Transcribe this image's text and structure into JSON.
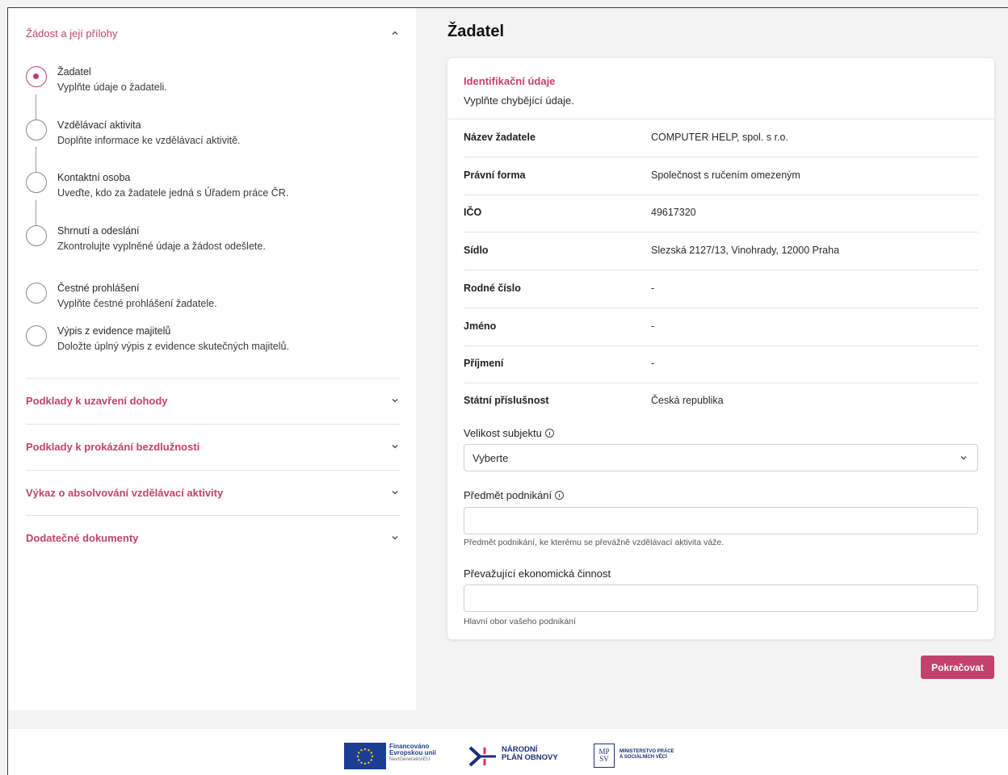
{
  "sidebar": {
    "section_open": {
      "title": "Žádost a její přílohy"
    },
    "steps": [
      {
        "title": "Žadatel",
        "desc": "Vyplňte údaje o žadateli."
      },
      {
        "title": "Vzdělávací aktivita",
        "desc": "Doplňte informace ke vzdělávací aktivitě."
      },
      {
        "title": "Kontaktní osoba",
        "desc": "Uveďte, kdo za žadatele jedná s Úřadem práce ČR."
      },
      {
        "title": "Shrnutí a odeslání",
        "desc": "Zkontrolujte vyplněné údaje a žádost odešlete."
      },
      {
        "title": "Čestné prohlášení",
        "desc": "Vyplňte čestné prohlášení žadatele."
      },
      {
        "title": "Výpis z evidence majitelů",
        "desc": "Doložte úplný výpis z evidence skutečných majitelů."
      }
    ],
    "sections_collapsed": [
      {
        "title": "Podklady k uzavření dohody"
      },
      {
        "title": "Podklady k prokázání bezdlužnosti"
      },
      {
        "title": "Výkaz o absolvování vzdělávací aktivity"
      },
      {
        "title": "Dodatečné dokumenty"
      }
    ]
  },
  "main": {
    "title": "Žadatel",
    "card": {
      "title": "Identifikační údaje",
      "subtitle": "Vyplňte chybějící údaje.",
      "rows": [
        {
          "label": "Název žadatele",
          "value": "COMPUTER HELP, spol. s r.o."
        },
        {
          "label": "Právní forma",
          "value": "Společnost s ručením omezeným"
        },
        {
          "label": "IČO",
          "value": "49617320"
        },
        {
          "label": "Sídlo",
          "value": "Slezská 2127/13, Vinohrady, 12000 Praha"
        },
        {
          "label": "Rodné číslo",
          "value": "-"
        },
        {
          "label": "Jméno",
          "value": "-"
        },
        {
          "label": "Příjmení",
          "value": "-"
        },
        {
          "label": "Státní příslušnost",
          "value": "Česká republika"
        }
      ],
      "size_field": {
        "label": "Velikost subjektu",
        "value": "Vyberte"
      },
      "business_field": {
        "label": "Předmět podnikání",
        "value": "",
        "hint": "Předmět podnikání, ke kterému se převážně vzdělávací aktivita váže."
      },
      "activity_field": {
        "label": "Převažující ekonomická činnost",
        "value": "",
        "hint": "Hlavní obor vašeho podnikání"
      }
    },
    "continue_label": "Pokračovat"
  },
  "footer": {
    "eu_line1": "Financováno",
    "eu_line2": "Evropskou unií",
    "eu_line3": "NextGenerationEU",
    "npo_line1": "NÁRODNÍ",
    "npo_line2": "PLÁN OBNOVY",
    "mpsv_line1": "MINISTERSTVO PRÁCE",
    "mpsv_line2": "A SOCIÁLNÍCH VĚCÍ",
    "mpsv_mark_top": "MP",
    "mpsv_mark_bottom": "SV"
  },
  "colors": {
    "accent": "#c2416d",
    "eu_blue": "#1b3e94",
    "footer_navy": "#1b2e78"
  }
}
